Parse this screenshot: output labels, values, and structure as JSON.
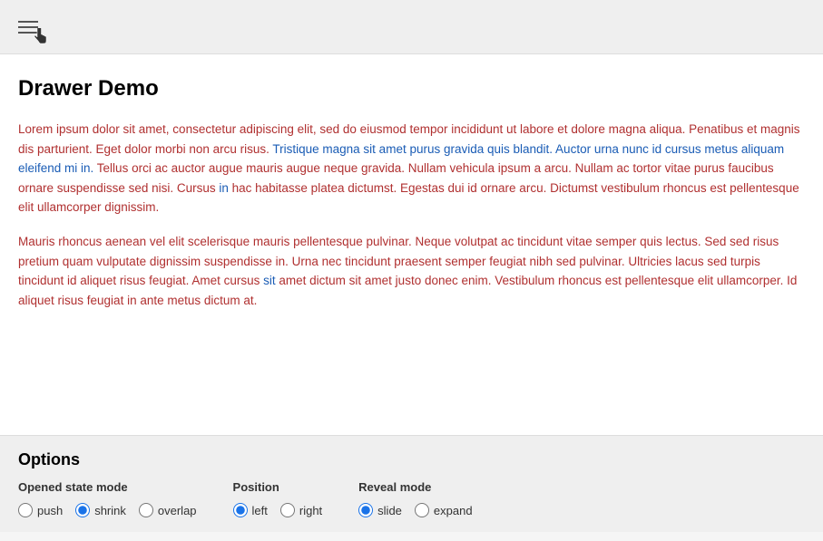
{
  "toolbar": {
    "menu_icon_label": "menu-icon"
  },
  "main": {
    "title": "Drawer Demo",
    "paragraph1": "Lorem ipsum dolor sit amet, consectetur adipiscing elit, sed do eiusmod tempor incididunt ut labore et dolore magna aliqua. Penatibus et magnis dis parturient. Eget dolor morbi non arcu risus. Tristique magna sit amet purus gravida quis blandit. Auctor urna nunc id cursus metus aliquam eleifend mi in. Tellus orci ac auctor augue mauris augue neque gravida. Nullam vehicula ipsum a arcu. Nullam ac tortor vitae purus faucibus ornare suspendisse sed nisi. Cursus in hac habitasse platea dictumst. Egestas dui id ornare arcu. Dictumst vestibulum rhoncus est pellentesque elit ullamcorper dignissim.",
    "paragraph2": "Mauris rhoncus aenean vel elit scelerisque mauris pellentesque pulvinar. Neque volutpat ac tincidunt vitae semper quis lectus. Sed sed risus pretium quam vulputate dignissim suspendisse in. Urna nec tincidunt praesent semper feugiat nibh sed pulvinar. Ultricies lacus sed turpis tincidunt id aliquet risus feugiat. Amet cursus sit amet dictum sit amet justo donec enim. Vestibulum rhoncus est pellentesque elit ullamcorper. Id aliquet risus feugiat in ante metus dictum at."
  },
  "options": {
    "title": "Options",
    "opened_state_mode": {
      "label": "Opened state mode",
      "items": [
        "push",
        "shrink",
        "overlap"
      ],
      "selected": "shrink"
    },
    "position": {
      "label": "Position",
      "items": [
        "left",
        "right"
      ],
      "selected": "left"
    },
    "reveal_mode": {
      "label": "Reveal mode",
      "items": [
        "slide",
        "expand"
      ],
      "selected": "slide"
    }
  }
}
